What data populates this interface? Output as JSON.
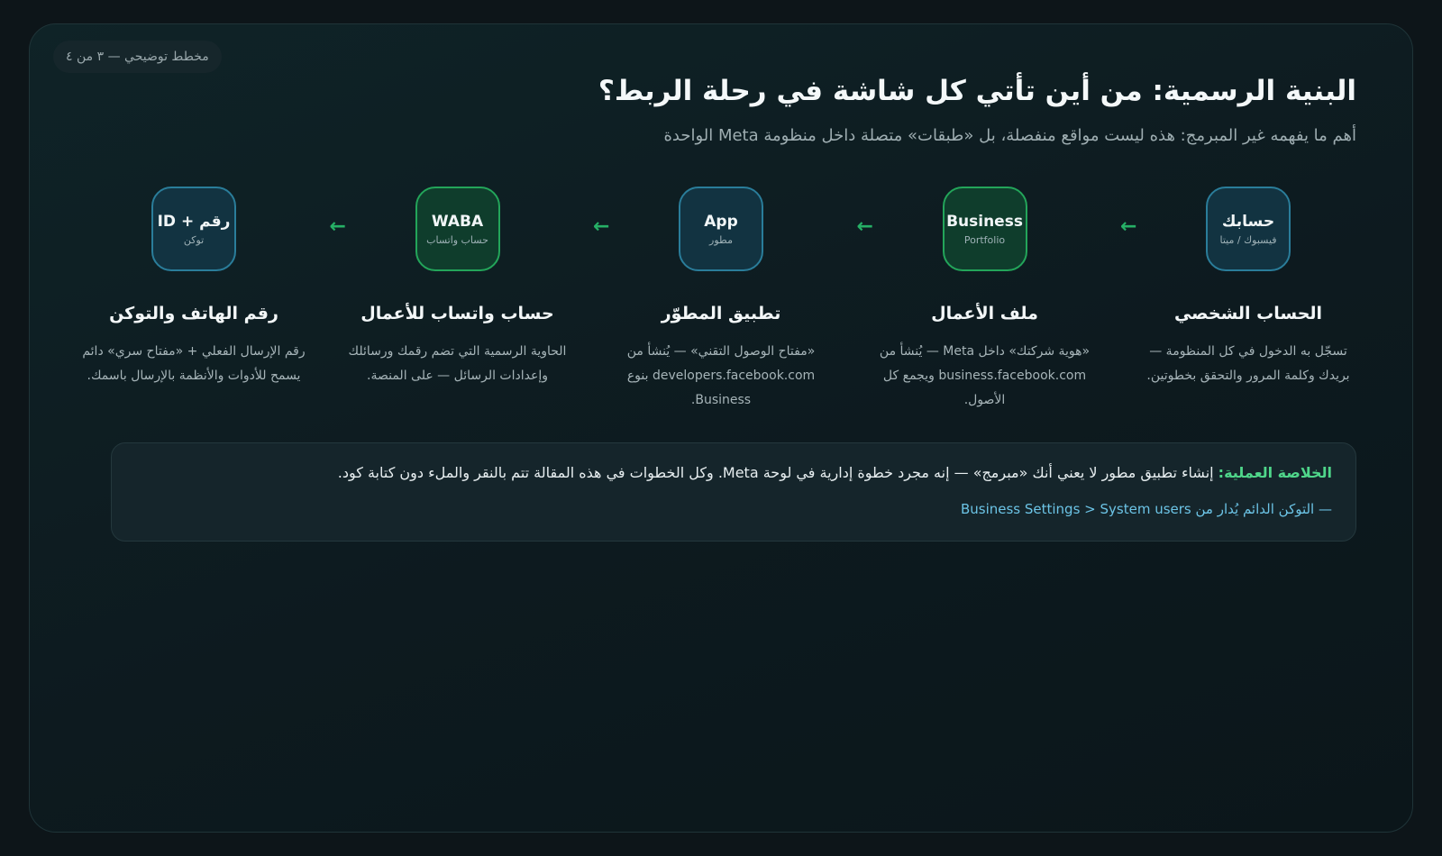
{
  "badge": "مخطط توضيحي — ٣ من ٤",
  "title": "البنية الرسمية: من أين تأتي كل شاشة في رحلة الربط؟",
  "subtitle": "أهم ما يفهمه غير المبرمج: هذه ليست مواقع منفصلة، بل «طبقات» متصلة داخل منظومة Meta الواحدة",
  "arrow_glyph": "←",
  "steps": [
    {
      "node_main": "حسابك",
      "node_sub": "فيسبوك / ميتا",
      "node_color": "blue",
      "title": "الحساب الشخصي",
      "desc": "تسجّل به الدخول في كل المنظومة — بريدك وكلمة المرور والتحقق بخطوتين."
    },
    {
      "node_main": "Business",
      "node_sub": "Portfolio",
      "node_color": "green",
      "title": "ملف الأعمال",
      "desc": "«هوية شركتك» داخل Meta — يُنشأ من business.facebook.com ويجمع كل الأصول."
    },
    {
      "node_main": "App",
      "node_sub": "مطور",
      "node_color": "blue",
      "title": "تطبيق المطوّر",
      "desc": "«مفتاح الوصول التقني» — يُنشأ من developers.facebook.com بنوع Business."
    },
    {
      "node_main": "WABA",
      "node_sub": "حساب واتساب",
      "node_color": "green",
      "title": "حساب واتساب للأعمال",
      "desc": "الحاوية الرسمية التي تضم رقمك ورسائلك وإعدادات الرسائل — على المنصة."
    },
    {
      "node_main": "رقم + ID",
      "node_sub": "توكن",
      "node_color": "blue",
      "title": "رقم الهاتف والتوكن",
      "desc": "رقم الإرسال الفعلي + «مفتاح سري» دائم يسمح للأدوات والأنظمة بالإرسال باسمك."
    }
  ],
  "summary": {
    "label": "الخلاصة العملية:",
    "text": " إنشاء تطبيق مطور لا يعني أنك «مبرمج» — إنه مجرد خطوة إدارية في لوحة Meta. وكل الخطوات في هذه المقالة تتم بالنقر والملء دون كتابة كود.",
    "note": "— التوكن الدائم يُدار من Business Settings > System users"
  },
  "colors": {
    "accent_green": "#26b066",
    "accent_blue": "#6cc4e6",
    "summary_label": "#4fd68a"
  }
}
